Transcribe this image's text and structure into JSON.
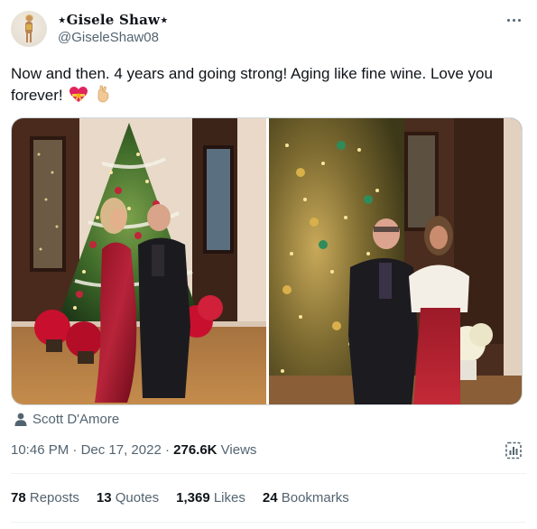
{
  "author": {
    "display_name": "⋆Gisele Shaw⋆",
    "handle": "@GiseleShaw08"
  },
  "tweet": {
    "text": "Now and then. 4 years and going strong! Aging like fine wine. Love you forever!",
    "emojis": [
      "heart-with-ribbon",
      "crossed-fingers"
    ]
  },
  "media_tag": {
    "icon": "person-icon",
    "label": "Scott D'Amore"
  },
  "meta": {
    "time": "10:46 PM",
    "separator": " · ",
    "date": "Dec 17, 2022",
    "views_count": "276.6K",
    "views_label": " Views"
  },
  "stats": [
    {
      "count": "78",
      "label": "Reposts"
    },
    {
      "count": "13",
      "label": "Quotes"
    },
    {
      "count": "1,369",
      "label": "Likes"
    },
    {
      "count": "24",
      "label": "Bookmarks"
    }
  ],
  "colors": {
    "text_primary": "#0f1419",
    "text_secondary": "#536471",
    "divider": "#eff3f4"
  }
}
